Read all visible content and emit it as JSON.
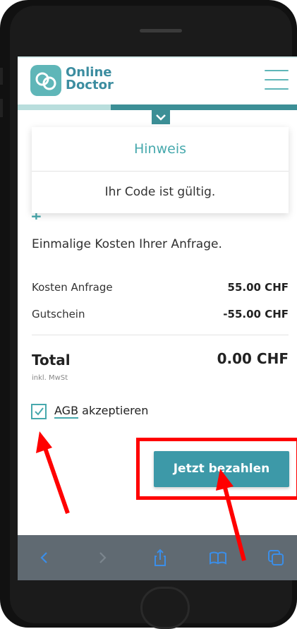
{
  "header": {
    "logo_line1": "Online",
    "logo_line2": "Doctor"
  },
  "hint": {
    "title": "Hinweis",
    "message": "Ihr Code ist gültig."
  },
  "content": {
    "plus_glyph": "+",
    "description": "Einmalige Kosten Ihrer Anfrage.",
    "rows": [
      {
        "label": "Kosten Anfrage",
        "value": "55.00 CHF"
      },
      {
        "label": "Gutschein",
        "value": "-55.00 CHF"
      }
    ],
    "total_label": "Total",
    "total_value": "0.00 CHF",
    "vat_note": "inkl. MwSt",
    "agb_link": "AGB",
    "agb_rest": " akzeptieren",
    "agb_checked": true,
    "pay_button": "Jetzt bezahlen"
  },
  "colors": {
    "brand": "#47a9ad",
    "button": "#3d99a8",
    "annotation": "#ff0000"
  }
}
